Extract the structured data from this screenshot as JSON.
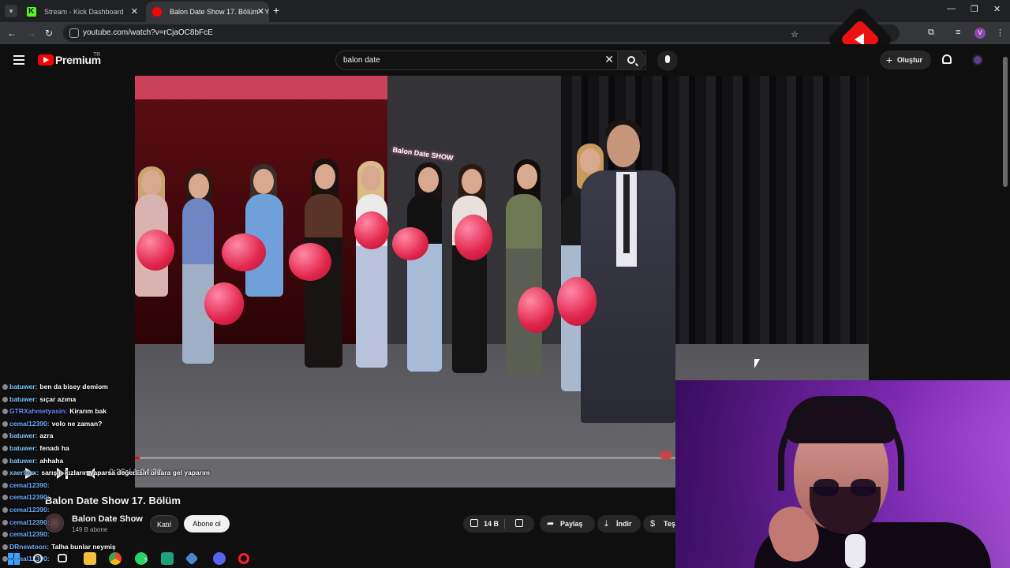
{
  "browser": {
    "tabs": [
      {
        "title": "Stream - Kick Dashboard",
        "favicon": "kick-icon"
      },
      {
        "title": "Balon Date Show 17. Bölüm - Yo",
        "favicon": "youtube-icon",
        "active": true
      }
    ],
    "url": "youtube.com/watch?v=rCjaOC8bFcE",
    "profile_initial": "V"
  },
  "youtube": {
    "brand": "Premium",
    "country": "TR",
    "search_value": "balon date",
    "create_label": "Oluştur"
  },
  "video": {
    "sign_text": "Balon Date SHOW",
    "current_time": "0:35",
    "duration": "1:04:30",
    "time_display": "0:35 / 1:04:30",
    "progress_fraction": 0.009,
    "title": "Balon Date Show 17. Bölüm",
    "channel": "Balon Date Show",
    "subscribers": "149 B abone",
    "join_label": "Katıl",
    "subscribe_label": "Abone ol",
    "likes": "14 B",
    "share_label": "Paylaş",
    "download_label": "İndir",
    "thanks_label": "Teş"
  },
  "chat": {
    "messages": [
      {
        "user": "batuwer:",
        "text": "ben da bisey demiom",
        "color": "#7ec8ff"
      },
      {
        "user": "batuwer:",
        "text": "sıçar azıma",
        "color": "#7ec8ff"
      },
      {
        "user": "GTRXahmetyasin:",
        "text": "Kirarım bak",
        "color": "#6a8cff"
      },
      {
        "user": "cemal12390:",
        "text": "volo ne zaman?",
        "color": "#6ab0ff"
      },
      {
        "user": "batuwer:",
        "text": "azra",
        "color": "#7ec8ff"
      },
      {
        "user": "batuwer:",
        "text": "fenadı ha",
        "color": "#7ec8ff"
      },
      {
        "user": "batuwer:",
        "text": "ahhaha",
        "color": "#7ec8ff"
      },
      {
        "user": "xaerloxx:",
        "text": "sarışın kızların yaparsa değerlisin onlara gel yaparım",
        "color": "#7ec8ff"
      },
      {
        "user": "cemal12390:",
        "text": "",
        "color": "#6ab0ff"
      },
      {
        "user": "cemal12390:",
        "text": "",
        "color": "#6ab0ff"
      },
      {
        "user": "cemal12390:",
        "text": "",
        "color": "#6ab0ff"
      },
      {
        "user": "cemal12390:",
        "text": "",
        "color": "#6ab0ff"
      },
      {
        "user": "cemal12390:",
        "text": "",
        "color": "#6ab0ff"
      },
      {
        "user": "DRnewtoon:",
        "text": "Talha bunlar neymiş",
        "color": "#6ab0ff"
      },
      {
        "user": "cemal12390:",
        "text": "",
        "color": "#6ab0ff"
      }
    ]
  },
  "taskbar": {
    "icons": [
      "windows-start-icon",
      "search-icon",
      "task-view-icon",
      "file-explorer-icon",
      "chrome-icon",
      "whatsapp-icon",
      "app-icon",
      "app-icon-2",
      "discord-icon",
      "opera-icon"
    ],
    "badge": "5"
  }
}
